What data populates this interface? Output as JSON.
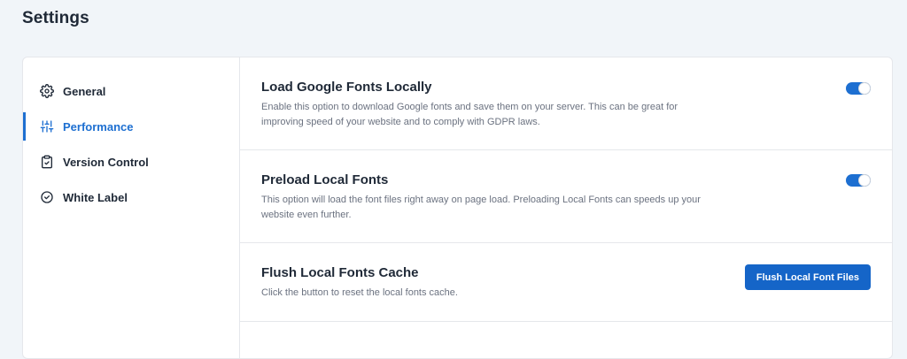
{
  "page": {
    "title": "Settings"
  },
  "sidebar": {
    "items": [
      {
        "label": "General",
        "icon": "gear-icon",
        "active": false
      },
      {
        "label": "Performance",
        "icon": "sliders-icon",
        "active": true
      },
      {
        "label": "Version Control",
        "icon": "clipboard-check-icon",
        "active": false
      },
      {
        "label": "White Label",
        "icon": "check-circle-icon",
        "active": false
      }
    ]
  },
  "settings": {
    "load_google_fonts": {
      "title": "Load Google Fonts Locally",
      "description": "Enable this option to download Google fonts and save them on your server. This can be great for improving speed of your website and to comply with GDPR laws.",
      "enabled": true
    },
    "preload_local_fonts": {
      "title": "Preload Local Fonts",
      "description": "This option will load the font files right away on page load. Preloading Local Fonts can speeds up your website even further.",
      "enabled": true
    },
    "flush_cache": {
      "title": "Flush Local Fonts Cache",
      "description": "Click the button to reset the local fonts cache.",
      "button_label": "Flush Local Font Files"
    }
  },
  "colors": {
    "accent": "#1d6fd1",
    "button": "#1565c8",
    "background": "#f1f5f9"
  }
}
